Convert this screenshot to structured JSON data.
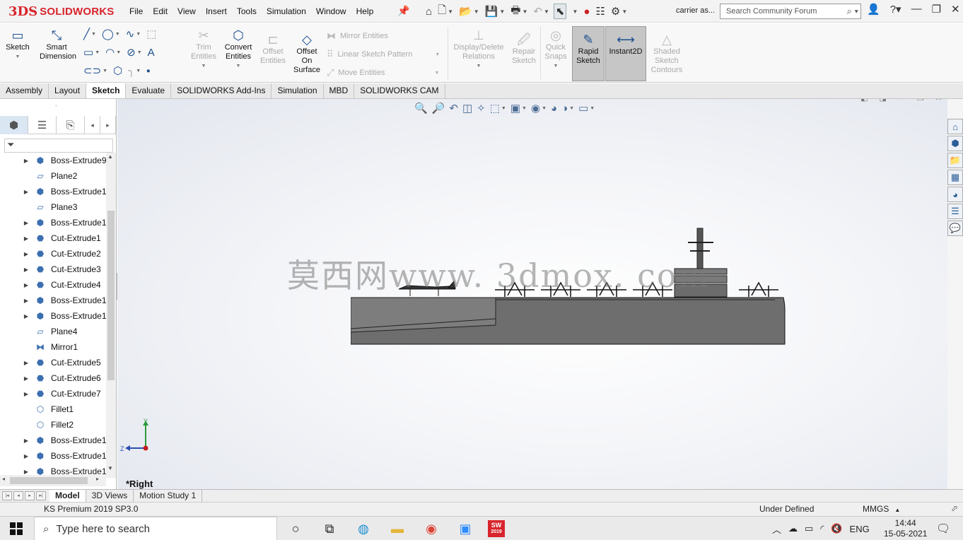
{
  "app": {
    "brand_mark": "3DS",
    "brand_name": "SOLIDWORKS"
  },
  "menu": [
    "File",
    "Edit",
    "View",
    "Insert",
    "Tools",
    "Simulation",
    "Window",
    "Help"
  ],
  "document": {
    "name": "carrier as..."
  },
  "search": {
    "placeholder": "Search Community Forum"
  },
  "ribbon": {
    "sketch": "Sketch",
    "smart_dimension": [
      "Smart",
      "Dimension"
    ],
    "trim": [
      "Trim",
      "Entities"
    ],
    "convert": [
      "Convert",
      "Entities"
    ],
    "offset": [
      "Offset",
      "Entities"
    ],
    "offset_surface": [
      "Offset",
      "On",
      "Surface"
    ],
    "mirror": "Mirror Entities",
    "linear_pattern": "Linear Sketch Pattern",
    "move": "Move Entities",
    "display_delete": [
      "Display/Delete",
      "Relations"
    ],
    "repair": [
      "Repair",
      "Sketch"
    ],
    "quick_snaps": [
      "Quick",
      "Snaps"
    ],
    "rapid_sketch": [
      "Rapid",
      "Sketch"
    ],
    "instant2d": "Instant2D",
    "shaded": [
      "Shaded",
      "Sketch",
      "Contours"
    ]
  },
  "tabs": [
    "Assembly",
    "Layout",
    "Sketch",
    "Evaluate",
    "SOLIDWORKS Add-Ins",
    "Simulation",
    "MBD",
    "SOLIDWORKS CAM"
  ],
  "active_tab": "Sketch",
  "tree": [
    {
      "name": "Boss-Extrude9",
      "type": "boss",
      "expandable": true
    },
    {
      "name": "Plane2",
      "type": "plane",
      "expandable": false
    },
    {
      "name": "Boss-Extrude1",
      "type": "boss",
      "expandable": true
    },
    {
      "name": "Plane3",
      "type": "plane",
      "expandable": false
    },
    {
      "name": "Boss-Extrude1",
      "type": "boss",
      "expandable": true
    },
    {
      "name": "Cut-Extrude1",
      "type": "cut",
      "expandable": true
    },
    {
      "name": "Cut-Extrude2",
      "type": "cut",
      "expandable": true
    },
    {
      "name": "Cut-Extrude3",
      "type": "cut",
      "expandable": true
    },
    {
      "name": "Cut-Extrude4",
      "type": "cut",
      "expandable": true
    },
    {
      "name": "Boss-Extrude1",
      "type": "boss",
      "expandable": true
    },
    {
      "name": "Boss-Extrude1",
      "type": "boss",
      "expandable": true
    },
    {
      "name": "Plane4",
      "type": "plane",
      "expandable": false
    },
    {
      "name": "Mirror1",
      "type": "mirror",
      "expandable": false
    },
    {
      "name": "Cut-Extrude5",
      "type": "cut",
      "expandable": true
    },
    {
      "name": "Cut-Extrude6",
      "type": "cut",
      "expandable": true
    },
    {
      "name": "Cut-Extrude7",
      "type": "cut",
      "expandable": true
    },
    {
      "name": "Fillet1",
      "type": "fillet",
      "expandable": false
    },
    {
      "name": "Fillet2",
      "type": "fillet",
      "expandable": false
    },
    {
      "name": "Boss-Extrude1",
      "type": "boss",
      "expandable": true
    },
    {
      "name": "Boss-Extrude1",
      "type": "boss",
      "expandable": true
    },
    {
      "name": "Boss-Extrude1",
      "type": "boss",
      "expandable": true
    }
  ],
  "viewport": {
    "view_name": "*Right",
    "watermark": "莫西网www. 3dmox. com"
  },
  "triad": {
    "y": "Y",
    "z": "Z"
  },
  "bottom_tabs": [
    "Model",
    "3D Views",
    "Motion Study 1"
  ],
  "status": {
    "version": "KS Premium 2019 SP3.0",
    "state": "Under Defined",
    "units": "MMGS"
  },
  "taskbar": {
    "search_placeholder": "Type here to search",
    "lang": "ENG",
    "time": "14:44",
    "date": "15-05-2021",
    "sw_year": "2019"
  },
  "colors": {
    "brand": "#d8242c",
    "hull": "#6e6e6e",
    "accent": "#1a4f8f"
  }
}
